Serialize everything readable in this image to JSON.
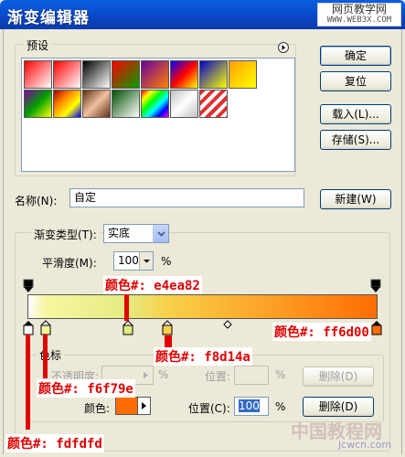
{
  "window": {
    "title": "渐变编辑器"
  },
  "watermark": {
    "line1": "网页教学网",
    "line2": "WWW.WEB3X.COM",
    "bottom": "中国教程网",
    "bottom_url": "jcwcn.com"
  },
  "presets": {
    "label": "预设",
    "menu_icon": "circle-arrow-right-icon",
    "swatches": [
      "linear-gradient(135deg,#ff0000,#ffffff)",
      "linear-gradient(135deg,#ff0000,rgba(255,0,0,0))",
      "linear-gradient(135deg,#000,#fff)",
      "linear-gradient(135deg,#ff0000,#00a000)",
      "linear-gradient(135deg,#6a00a0,#ff8000)",
      "linear-gradient(135deg,#0000ff,#ff0000,#ffff00)",
      "linear-gradient(135deg,#0000cc,#ffff00)",
      "linear-gradient(135deg,#ffa000,#ffff00)",
      "linear-gradient(135deg,#8000a0,#00a000,#ffff00)",
      "linear-gradient(135deg,#a00000,#ff8000,#ffff00,#0000ff)",
      "linear-gradient(135deg,#603010,#f0c0a0,#603010)",
      "linear-gradient(135deg,#005000,#ffffff)",
      "linear-gradient(135deg,#ff0000,#ffff00,#00ff00,#00ffff,#0000ff,#ff00ff)",
      "linear-gradient(135deg,#c0c0c0,#ffffff,#c0c0c0)",
      "repeating-linear-gradient(135deg,#e03030 0 4px,#ffffff 4px 8px)"
    ]
  },
  "buttons": {
    "ok": "确定",
    "reset": "复位",
    "load": "载入(L)...",
    "save": "存储(S)...",
    "new": "新建(W)",
    "delete": "删除(D)"
  },
  "name": {
    "label": "名称(N):",
    "value": "自定"
  },
  "gradient_type": {
    "label": "渐变类型(T):",
    "value": "实底"
  },
  "smoothness": {
    "label": "平滑度(M):",
    "value": "100",
    "unit": "%"
  },
  "color_labels": {
    "a": "颜色#: e4ea82",
    "b": "颜色#: ff6d00",
    "c": "颜色#: f8d14a",
    "d": "颜色#: f6f79e",
    "e": "颜色#: fdfdfd"
  },
  "stops_group": {
    "label": "色标",
    "opacity_label": "不透明度:",
    "percent": "%",
    "location_label": "位置:",
    "color_label": "颜色:",
    "color_location_label": "位置(C):",
    "color_location_value": "100",
    "swatch_color": "#ff6d00"
  }
}
